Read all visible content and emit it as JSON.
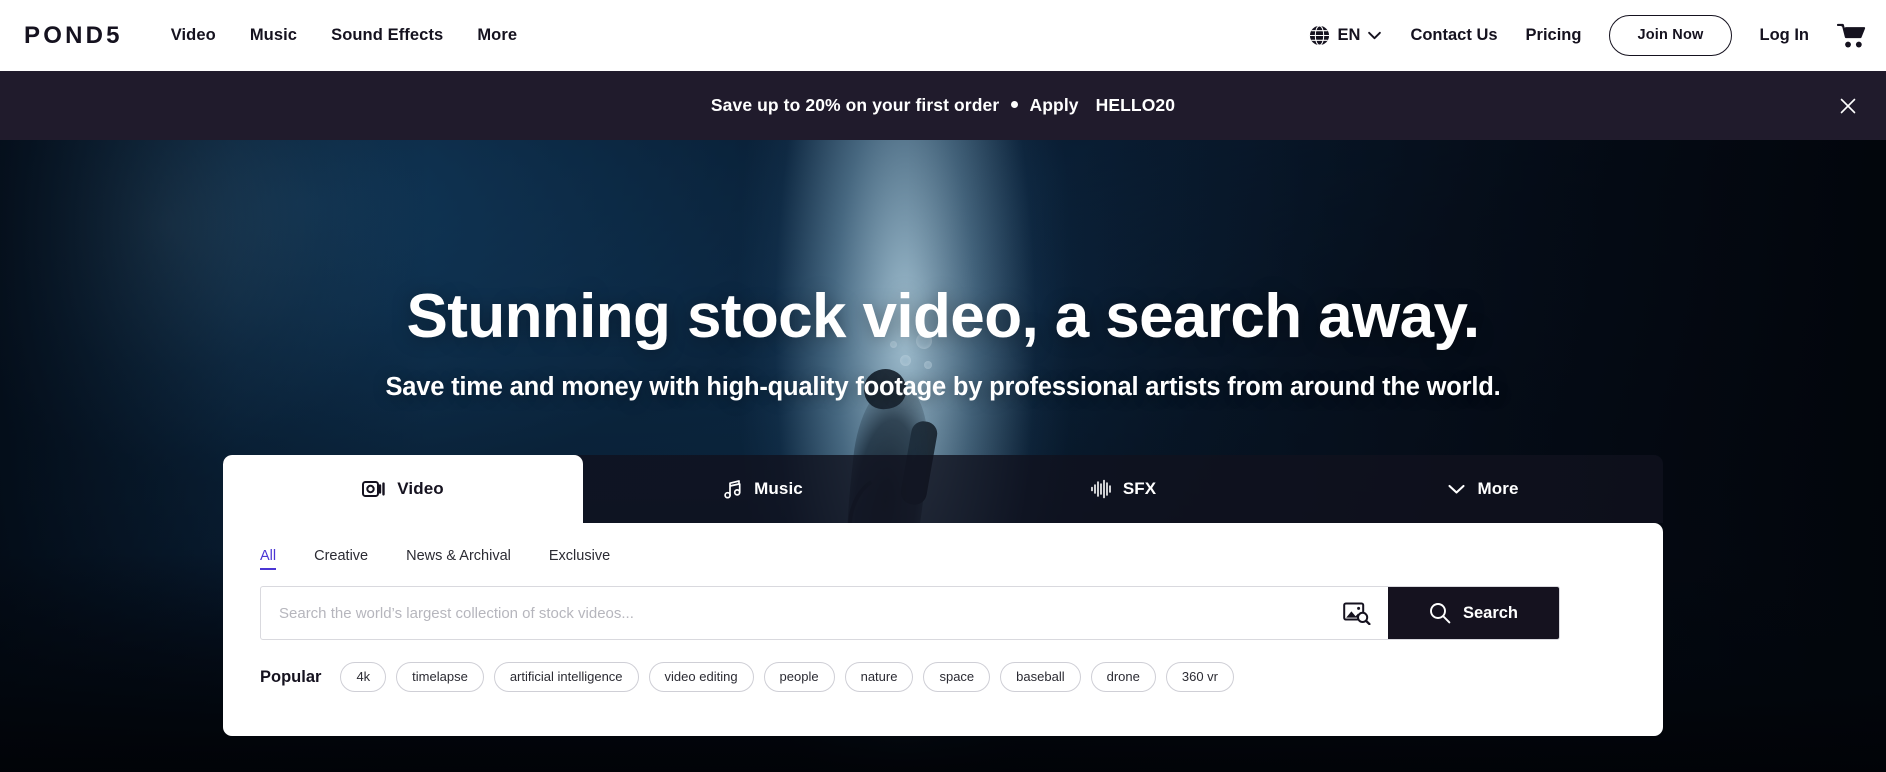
{
  "brand": {
    "logo": "POND5",
    "accent": "#4b36d4",
    "dark": "#15121f",
    "banner_bg": "#201b2c"
  },
  "topnav": {
    "left_links": [
      {
        "label": "Video"
      },
      {
        "label": "Music"
      },
      {
        "label": "Sound Effects"
      },
      {
        "label": "More"
      }
    ],
    "language": {
      "label": "EN",
      "icon": "globe-icon",
      "chevron": "chevron-down-icon"
    },
    "right_links": [
      {
        "label": "Contact Us"
      },
      {
        "label": "Pricing"
      }
    ],
    "join_button": "Join Now",
    "login_link": "Log In",
    "cart_icon": "shopping-cart-icon"
  },
  "promo": {
    "text_before": "Save up to 20% on your first order",
    "separator": "●",
    "apply_label": "Apply",
    "code": "HELLO20",
    "close_icon": "close-icon"
  },
  "hero": {
    "title": "Stunning stock video, a search away.",
    "subtitle": "Save time and money with high-quality footage by professional artists from around the world.",
    "background_description": "underwater scuba diver silhouette with light shaft"
  },
  "search_panel": {
    "tabs": [
      {
        "label": "Video",
        "icon": "video-camera-icon",
        "active": true
      },
      {
        "label": "Music",
        "icon": "music-note-icon",
        "active": false
      },
      {
        "label": "SFX",
        "icon": "waveform-icon",
        "active": false
      },
      {
        "label": "More",
        "icon": "chevron-down-icon",
        "active": false
      }
    ],
    "subtabs": [
      {
        "label": "All",
        "active": true
      },
      {
        "label": "Creative",
        "active": false
      },
      {
        "label": "News & Archival",
        "active": false
      },
      {
        "label": "Exclusive",
        "active": false
      }
    ],
    "search": {
      "value": "",
      "placeholder": "Search the world’s largest collection of stock videos...",
      "image_search_icon": "image-search-icon",
      "button_label": "Search",
      "button_icon": "magnifier-icon"
    },
    "popular": {
      "label": "Popular",
      "tags": [
        "4k",
        "timelapse",
        "artificial intelligence",
        "video editing",
        "people",
        "nature",
        "space",
        "baseball",
        "drone",
        "360 vr"
      ]
    }
  }
}
